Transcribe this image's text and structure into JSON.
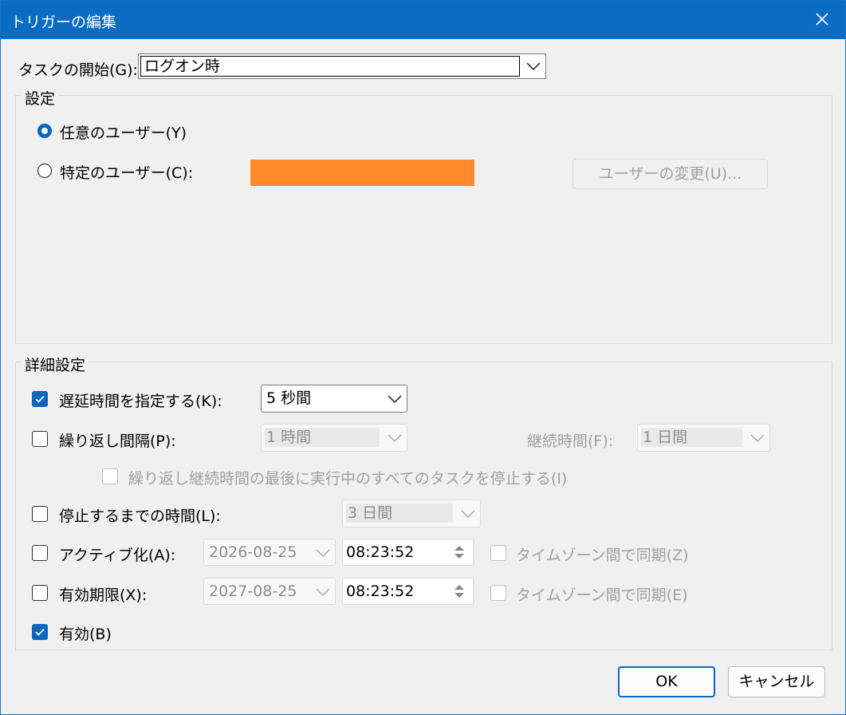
{
  "window": {
    "title": "トリガーの編集"
  },
  "start": {
    "label": "タスクの開始(G):",
    "value": "ログオン時"
  },
  "settings": {
    "group_label": "設定",
    "any_user_label": "任意のユーザー(Y)",
    "specific_user_label": "特定のユーザー(C):",
    "change_user_button": "ユーザーの変更(U)..."
  },
  "advanced": {
    "group_label": "詳細設定",
    "delay": {
      "label": "遅延時間を指定する(K):",
      "value": "5 秒間",
      "checked": true
    },
    "repeat": {
      "label": "繰り返し間隔(P):",
      "value": "1 時間",
      "checked": false
    },
    "duration": {
      "label": "継続時間(F):",
      "value": "1 日間"
    },
    "stop_all": {
      "label": "繰り返し継続時間の最後に実行中のすべてのタスクを停止する(I)"
    },
    "stop_after": {
      "label": "停止するまでの時間(L):",
      "value": "3 日間",
      "checked": false
    },
    "activate": {
      "label": "アクティブ化(A):",
      "date": "2026-08-25",
      "time": "08:23:52",
      "sync_label": "タイムゾーン間で同期(Z)",
      "checked": false
    },
    "expire": {
      "label": "有効期限(X):",
      "date": "2027-08-25",
      "time": "08:23:52",
      "sync_label": "タイムゾーン間で同期(E)",
      "checked": false
    },
    "enabled": {
      "label": "有効(B)",
      "checked": true
    }
  },
  "buttons": {
    "ok": "OK",
    "cancel": "キャンセル"
  },
  "colors": {
    "accent": "#0a67c0",
    "redaction": "#ff8a2a",
    "titlebar": "#0a6cc2"
  }
}
